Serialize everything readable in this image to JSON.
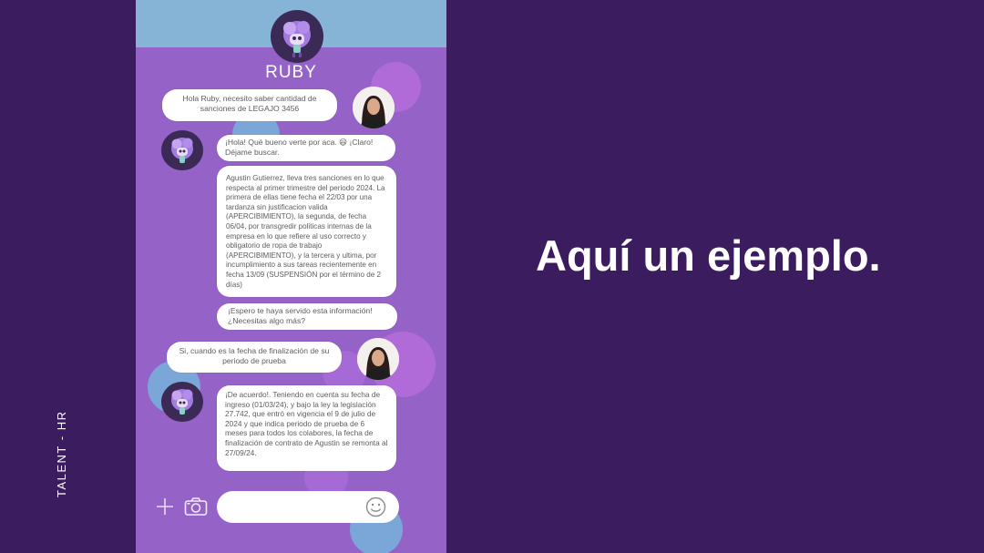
{
  "slide": {
    "side_label": "TALENT - HR",
    "headline": "Aquí un ejemplo."
  },
  "chat": {
    "app_name": "RUBY",
    "messages": [
      {
        "sender": "user",
        "text": "Hola Ruby, necesito saber cantidad de sanciones de LEGAJO 3456"
      },
      {
        "sender": "bot",
        "text": "¡Hola! Qué bueno verte por aca. 😃 ¡Claro! Déjame buscar."
      },
      {
        "sender": "bot",
        "text": "Agustin Gutierrez, lleva tres sanciones en lo que respecta al primer trimestre del periodo 2024. La primera de ellas tiene fecha el 22/03 por una tardanza sin justificacion valida (APERCIBIMIENTO), la segunda, de fecha 06/04, por transgredir politicas internas de la empresa en lo que refiere al uso correcto y obligatorio de ropa de trabajo (APERCIBIMIENTO), y la tercera y ultima, por incumplimiento a sus tareas recientemente en fecha 13/09 (SUSPENSIÓN por el término de 2 días)"
      },
      {
        "sender": "bot",
        "text": "¡Espero te haya servido esta información! ¿Necesitas algo más?"
      },
      {
        "sender": "user",
        "text": "Si, cuando es la fecha de finalización de su periodo de prueba"
      },
      {
        "sender": "bot",
        "text": "¡De acuerdo!. Teniendo en cuenta su fecha de ingreso (01/03/24), y bajo la ley la legislación 27.742, que entró en vigencia el 9 de julio de 2024 y que indica periodo de prueba de 6 meses para todos los colabores, la fecha de finalización de contrato de Agustin se remonta al 27/09/24."
      }
    ],
    "composer": {
      "value": "",
      "icons": [
        "plus-icon",
        "camera-icon",
        "emoji-icon"
      ]
    }
  },
  "colors": {
    "slide_background": "#3b1c5e",
    "phone_background": "#9562c7",
    "phone_header": "#86b4d7",
    "bubble": "#ffffff",
    "text": "#5d5d5d"
  }
}
